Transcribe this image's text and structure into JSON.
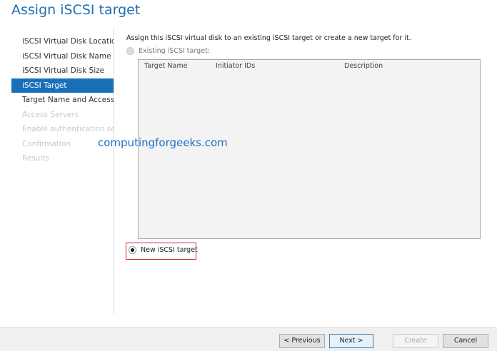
{
  "title": "Assign iSCSI target",
  "nav": [
    {
      "label": "iSCSI Virtual Disk Location",
      "state": "normal"
    },
    {
      "label": "iSCSI Virtual Disk Name",
      "state": "normal"
    },
    {
      "label": "iSCSI Virtual Disk Size",
      "state": "normal"
    },
    {
      "label": "iSCSI Target",
      "state": "active"
    },
    {
      "label": "Target Name and Access",
      "state": "normal"
    },
    {
      "label": "Access Servers",
      "state": "disabled"
    },
    {
      "label": "Enable authentication ser",
      "state": "disabled"
    },
    {
      "label": "Confirmation",
      "state": "disabled"
    },
    {
      "label": "Results",
      "state": "disabled"
    }
  ],
  "intro": "Assign this iSCSI virtual disk to an existing iSCSI target or create a new target for it.",
  "existing_label": "Existing iSCSI target:",
  "columns": [
    "Target Name",
    "Initiator IDs",
    "Description"
  ],
  "new_label": "New iSCSI target",
  "watermark": "computingforgeeks.com",
  "buttons": {
    "previous": "< Previous",
    "next": "Next >",
    "create": "Create",
    "cancel": "Cancel"
  }
}
